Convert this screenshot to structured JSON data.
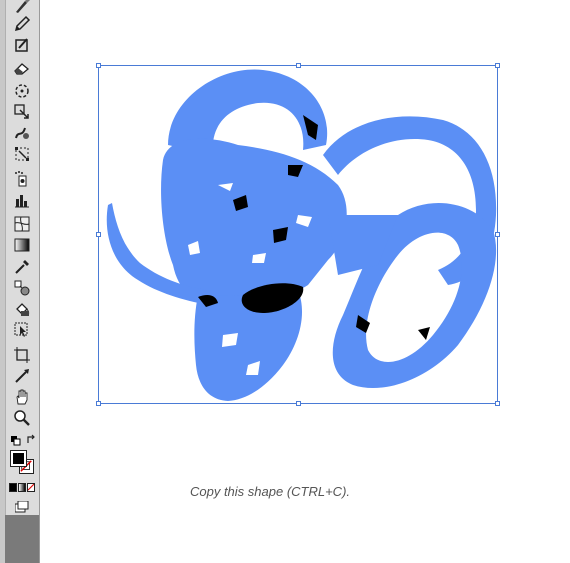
{
  "toolbar": {
    "tools": [
      {
        "name": "paintbrush-icon"
      },
      {
        "name": "pencil-icon"
      },
      {
        "name": "blob-brush-icon"
      },
      {
        "name": "eraser-icon"
      },
      {
        "name": "rotate-icon"
      },
      {
        "name": "scale-icon"
      },
      {
        "name": "warp-icon"
      },
      {
        "name": "free-transform-icon"
      },
      {
        "name": "symbol-sprayer-icon"
      },
      {
        "name": "column-graph-icon"
      },
      {
        "name": "mesh-icon"
      },
      {
        "name": "gradient-icon"
      },
      {
        "name": "eyedropper-icon"
      },
      {
        "name": "blend-icon"
      },
      {
        "name": "live-paint-bucket-icon"
      },
      {
        "name": "live-paint-selection-icon"
      },
      {
        "name": "artboard-icon"
      },
      {
        "name": "slice-icon"
      },
      {
        "name": "hand-icon"
      },
      {
        "name": "zoom-icon"
      }
    ],
    "fill_color": "#000000",
    "stroke_color": "none"
  },
  "canvas": {
    "caption": "Copy this shape (CTRL+C).",
    "artwork_color": "#5b8ff5",
    "selection_color": "#4a7bd6"
  }
}
